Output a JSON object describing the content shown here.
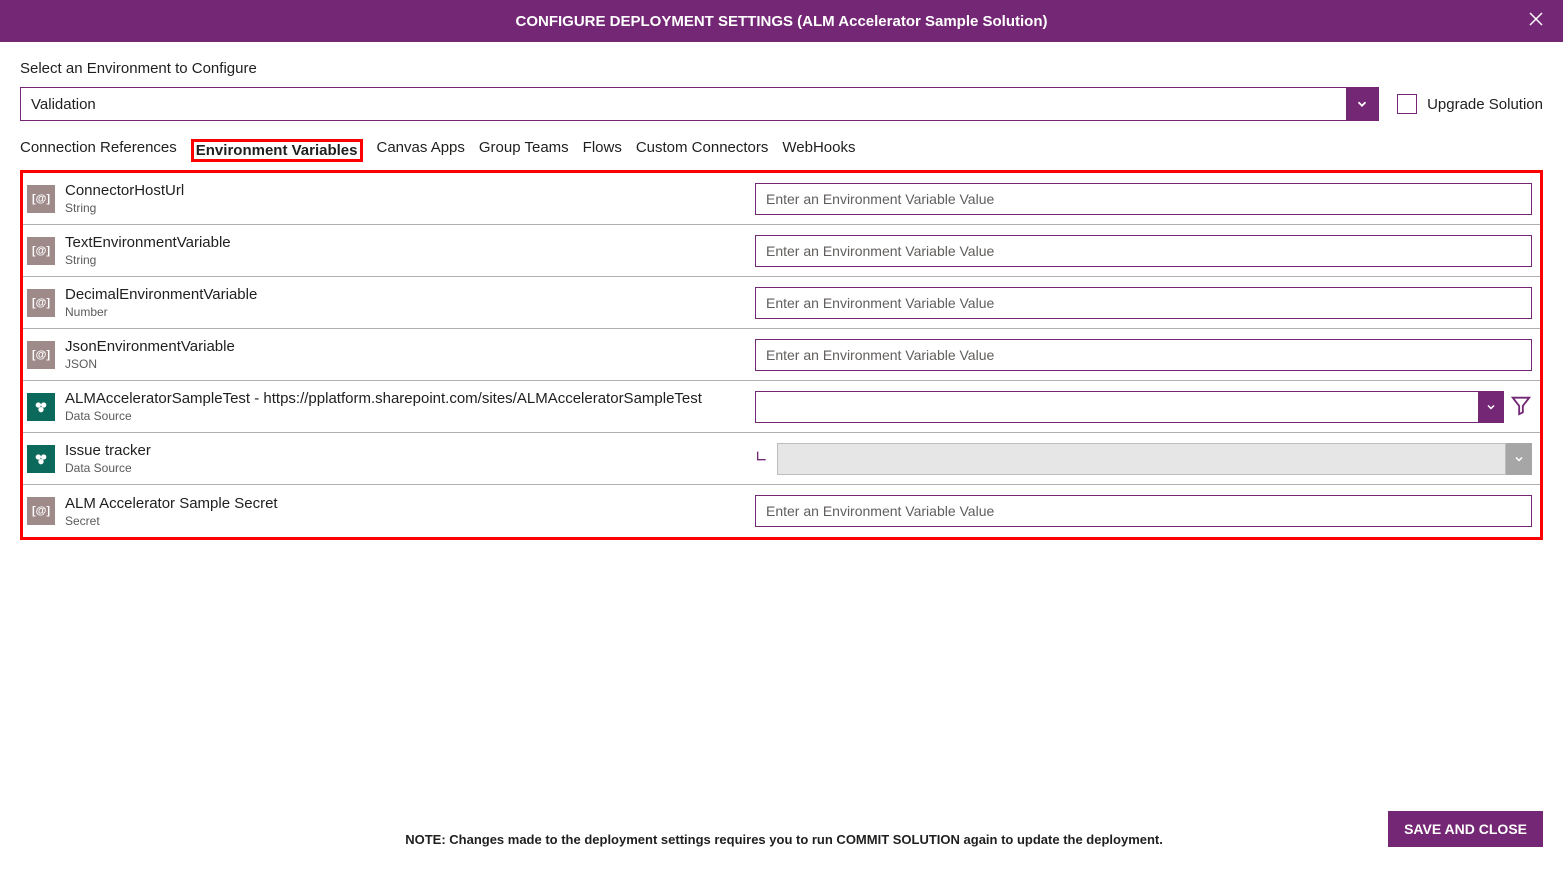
{
  "header": {
    "title": "CONFIGURE DEPLOYMENT SETTINGS (ALM Accelerator Sample Solution)"
  },
  "environment": {
    "label": "Select an Environment to Configure",
    "selected": "Validation",
    "upgrade_label": "Upgrade Solution"
  },
  "tabs": [
    {
      "label": "Connection References",
      "active": false
    },
    {
      "label": "Environment Variables",
      "active": true
    },
    {
      "label": "Canvas Apps",
      "active": false
    },
    {
      "label": "Group Teams",
      "active": false
    },
    {
      "label": "Flows",
      "active": false
    },
    {
      "label": "Custom Connectors",
      "active": false
    },
    {
      "label": "WebHooks",
      "active": false
    }
  ],
  "variables": [
    {
      "name": "ConnectorHostUrl",
      "type": "String",
      "input_kind": "text",
      "placeholder": "Enter an Environment Variable Value",
      "icon": "var"
    },
    {
      "name": "TextEnvironmentVariable",
      "type": "String",
      "input_kind": "text",
      "placeholder": "Enter an Environment Variable Value",
      "icon": "var"
    },
    {
      "name": "DecimalEnvironmentVariable",
      "type": "Number",
      "input_kind": "text",
      "placeholder": "Enter an Environment Variable Value",
      "icon": "var"
    },
    {
      "name": "JsonEnvironmentVariable",
      "type": "JSON",
      "input_kind": "text",
      "placeholder": "Enter an Environment Variable Value",
      "icon": "var"
    },
    {
      "name": "ALMAcceleratorSampleTest - https://pplatform.sharepoint.com/sites/ALMAcceleratorSampleTest",
      "type": "Data Source",
      "input_kind": "combo_filter",
      "icon": "sp"
    },
    {
      "name": "Issue tracker",
      "type": "Data Source",
      "input_kind": "combo_disabled_dependent",
      "icon": "sp"
    },
    {
      "name": "ALM Accelerator Sample Secret",
      "type": "Secret",
      "input_kind": "text",
      "placeholder": "Enter an Environment Variable Value",
      "icon": "var"
    }
  ],
  "footer": {
    "note": "NOTE: Changes made to the deployment settings requires you to run COMMIT SOLUTION again to update the deployment.",
    "save_label": "SAVE AND CLOSE"
  }
}
